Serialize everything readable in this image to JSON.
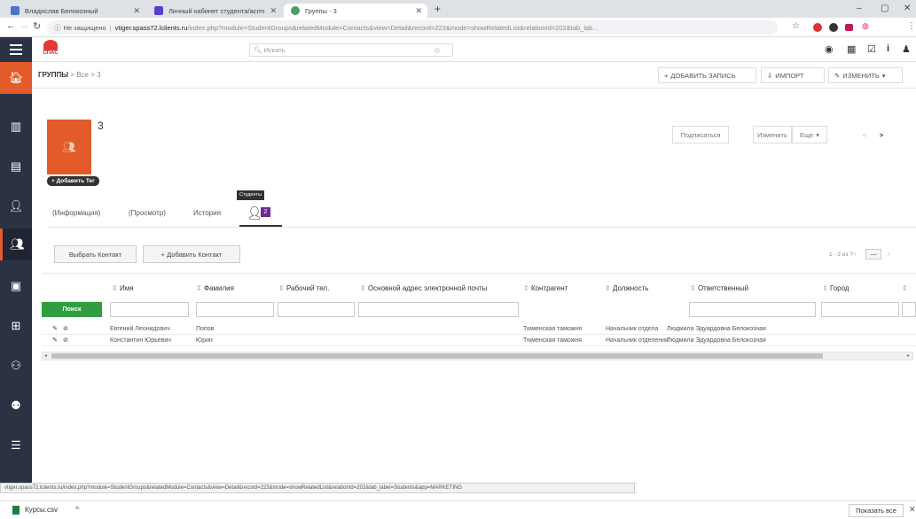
{
  "browser": {
    "tabs": [
      {
        "title": "Владислав Белокозный"
      },
      {
        "title": "Личный кабинет студента/acrm"
      },
      {
        "title": "Группы - 3"
      }
    ],
    "new_tab": "+",
    "window_controls": {
      "minimize": "–",
      "maximize": "▢",
      "close": "✕"
    },
    "not_secure": "Не защищено",
    "url_host": "vtiger.spass72.lclients.ru",
    "url_path": "/index.php?module=StudentGroups&relatedModule=Contacts&view=Detail&record=223&mode=showRelatedList&relationId=202&tab_lab..."
  },
  "app": {
    "logo_text": "СПАС",
    "search_placeholder": "Искать",
    "top_icons": [
      "timer-icon",
      "calendar-icon",
      "task-icon",
      "info-icon",
      "user-icon"
    ]
  },
  "breadcrumb": {
    "module": "ГРУППЫ",
    "sep1": ">",
    "filter": "Все",
    "sep2": ">",
    "record": "3"
  },
  "header_buttons": {
    "add": "ДОБАВИТЬ ЗАПИСЬ",
    "import": "ИМПОРТ",
    "edit": "ИЗМЕНИТЬ"
  },
  "record": {
    "name": "3",
    "add_tag": "+ Добавить Тег"
  },
  "record_buttons": {
    "subscribe": "Подписаться",
    "edit": "Изменить",
    "more": "Еще",
    "prev": "<",
    "next": ">"
  },
  "detail_tabs": {
    "info": "(Информация)",
    "view": "(Просмотр)",
    "history": "История",
    "students_tooltip": "Студенты",
    "students_count": "2"
  },
  "related": {
    "select_contact": "Выбрать Контакт",
    "add_contact": "+ Добавить Контакт",
    "pagination": "1 - 2 из ?",
    "more": "—"
  },
  "table": {
    "columns": [
      "Имя",
      "Фамилия",
      "Рабочий тел.",
      "Основной адрес электронной почты",
      "Контрагент",
      "Должность",
      "Ответственный",
      "Город"
    ],
    "search_button": "Поиск",
    "rows": [
      {
        "first": "Евгений Леонидович",
        "last": "Попов",
        "phone": "",
        "email": "",
        "account": "Тюменская таможня",
        "title": "Начальник отдела",
        "owner": "Людмила Эдуардовна Белокозная",
        "city": ""
      },
      {
        "first": "Константин Юрьевич",
        "last": "Юрин",
        "phone": "",
        "email": "",
        "account": "Тюменская таможня",
        "title": "Начальник отделения",
        "owner": "Людмила Эдуардовна Белокозная",
        "city": ""
      }
    ]
  },
  "status_url": "vtiger.spass72.lclients.ru/index.php?module=StudentGroups&relatedModule=Contacts&view=Detail&record=223&mode=showRelatedList&relationId=202&tab_label=Students&app=MARKETING",
  "downloads": {
    "file": "Курсы.csv",
    "show_all": "Показать все"
  },
  "colors": {
    "nav_bg": "#2b3243",
    "accent": "#e35b2a",
    "search_green": "#2e9e3f",
    "badge": "#6a2c91"
  }
}
